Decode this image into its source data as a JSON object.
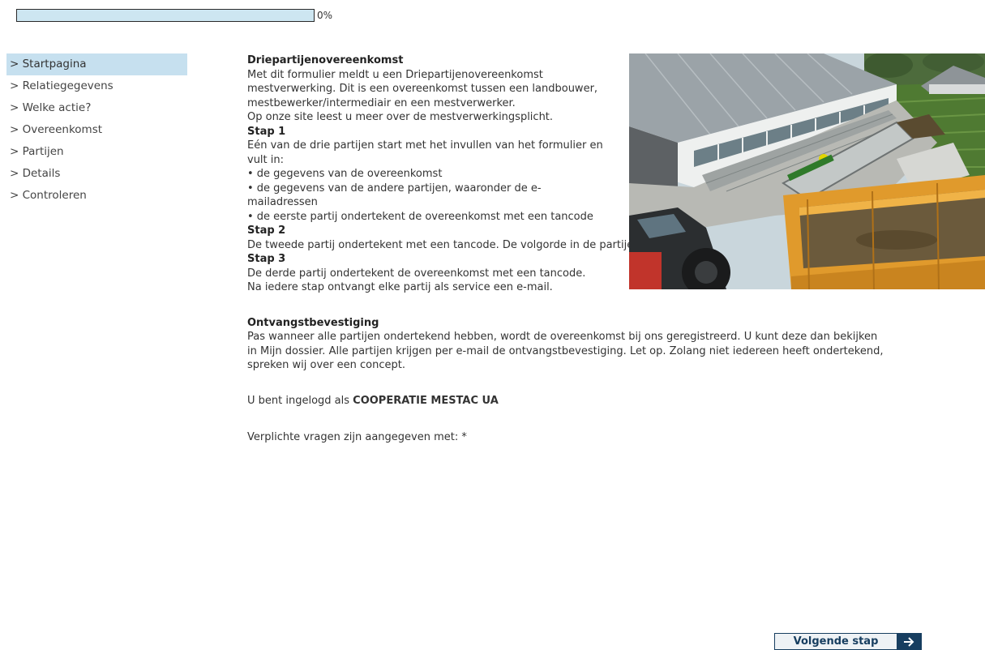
{
  "progress": {
    "value_percent": 0,
    "label": "0%"
  },
  "nav": {
    "items": [
      {
        "label": "> Startpagina",
        "active": true
      },
      {
        "label": "> Relatiegegevens"
      },
      {
        "label": "> Welke actie?"
      },
      {
        "label": "> Overeenkomst"
      },
      {
        "label": "> Partijen"
      },
      {
        "label": "> Details"
      },
      {
        "label": "> Controleren"
      }
    ]
  },
  "content": {
    "title": "Driepartijenovereenkomst",
    "intro": "Met dit formulier meldt u een Driepartijenovereenkomst mestverwerking. Dit is een overeenkomst tussen een landbouwer, mestbewerker/intermediair en een mestverwerker.",
    "site_note": "Op onze site leest u meer over de mestverwerkingsplicht.",
    "step1": {
      "heading": "Stap 1",
      "text": "Eén van de drie partijen start met het invullen van het formulier en vult in:",
      "bullets": [
        "• de gegevens van de overeenkomst",
        "• de gegevens van de andere partijen, waaronder de e-mailadressen",
        "• de eerste partij ondertekent de overeenkomst met een tancode"
      ]
    },
    "step2": {
      "heading": "Stap 2",
      "text": "De tweede partij ondertekent met een tancode. De volgorde in de partijen maakt niet uit."
    },
    "step3": {
      "heading": "Stap 3",
      "text": "De derde partij ondertekent de overeenkomst met een tancode."
    },
    "email_note": "Na iedere stap ontvangt elke partij als service een e-mail.",
    "confirmation": {
      "heading": "Ontvangstbevestiging",
      "text": "Pas wanneer alle partijen ondertekend hebben, wordt de overeenkomst bij ons geregistreerd. U kunt deze dan bekijken in Mijn dossier. Alle partijen krijgen per e-mail de ontvangstbevestiging. Let op. Zolang niet iedereen heeft ondertekend, spreken wij over een concept."
    },
    "login_prefix": "U bent ingelogd als ",
    "login_name": "COOPERATIE MESTAC UA",
    "required_note": "Verplichte vragen zijn aangegeven met: *"
  },
  "buttons": {
    "next_label": "Volgende stap",
    "next_icon": "arrow-right-icon"
  }
}
